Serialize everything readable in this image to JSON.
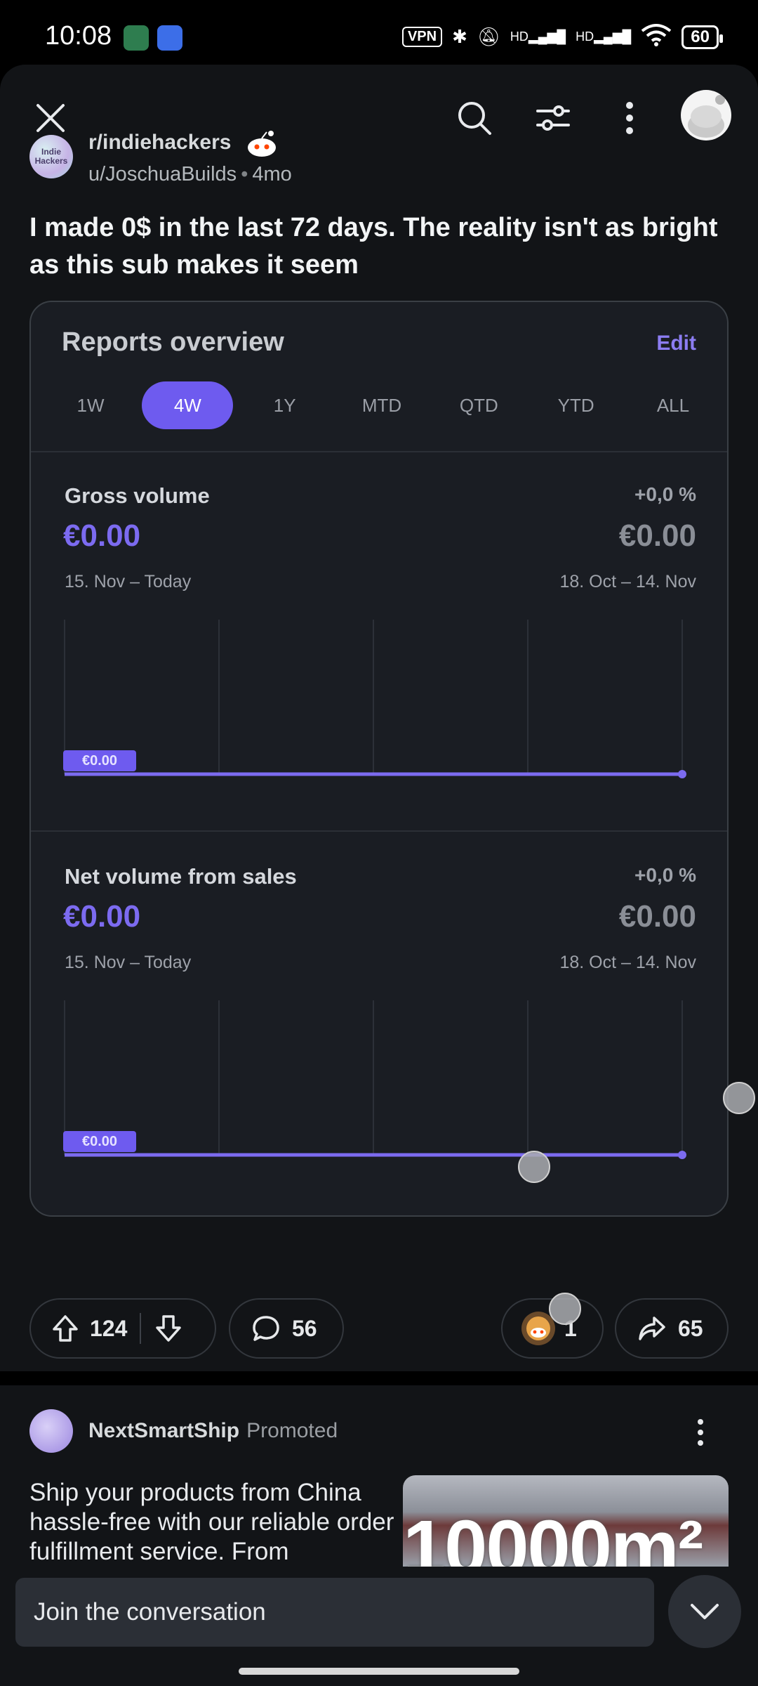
{
  "status_bar": {
    "time": "10:08",
    "vpn": "VPN",
    "hd1": "HD",
    "hd2": "HD",
    "battery": "60"
  },
  "post": {
    "subreddit": "r/indiehackers",
    "subreddit_avatar_text": "Indie Hackers",
    "author": "u/JoschuaBuilds",
    "age": "4mo",
    "title": "I made 0$ in the last 72 days. The reality isn't as bright as this sub makes it seem"
  },
  "report": {
    "title": "Reports overview",
    "edit": "Edit",
    "ranges": [
      "1W",
      "4W",
      "1Y",
      "MTD",
      "QTD",
      "YTD",
      "ALL"
    ],
    "active_range": "4W",
    "metrics": [
      {
        "label": "Gross volume",
        "change": "+0,0 %",
        "value": "€0.00",
        "previous_value": "€0.00",
        "range": "15. Nov – Today",
        "previous_range": "18. Oct – 14. Nov",
        "chart_tag": "€0.00"
      },
      {
        "label": "Net volume from sales",
        "change": "+0,0 %",
        "value": "€0.00",
        "previous_value": "€0.00",
        "range": "15. Nov – Today",
        "previous_range": "18. Oct – 14. Nov",
        "chart_tag": "€0.00"
      }
    ]
  },
  "actions": {
    "upvotes": "124",
    "comments": "56",
    "awards": "1",
    "shares": "65"
  },
  "promoted": {
    "advertiser": "NextSmartShip",
    "tag": "Promoted",
    "text": "Ship your products from China hassle-free with our reliable order fulfillment service. From",
    "image_text": "10000m²"
  },
  "composer": {
    "placeholder": "Join the conversation"
  },
  "colors": {
    "accent": "#6e5bef",
    "background": "#121417"
  },
  "chart_data": [
    {
      "type": "line",
      "series": [
        {
          "values": [
            0,
            0,
            0,
            0,
            0
          ]
        }
      ],
      "ylim": [
        0,
        1
      ],
      "grid": "vertical"
    },
    {
      "type": "line",
      "series": [
        {
          "values": [
            0,
            0,
            0,
            0,
            0
          ]
        }
      ],
      "ylim": [
        0,
        1
      ],
      "grid": "vertical"
    }
  ]
}
